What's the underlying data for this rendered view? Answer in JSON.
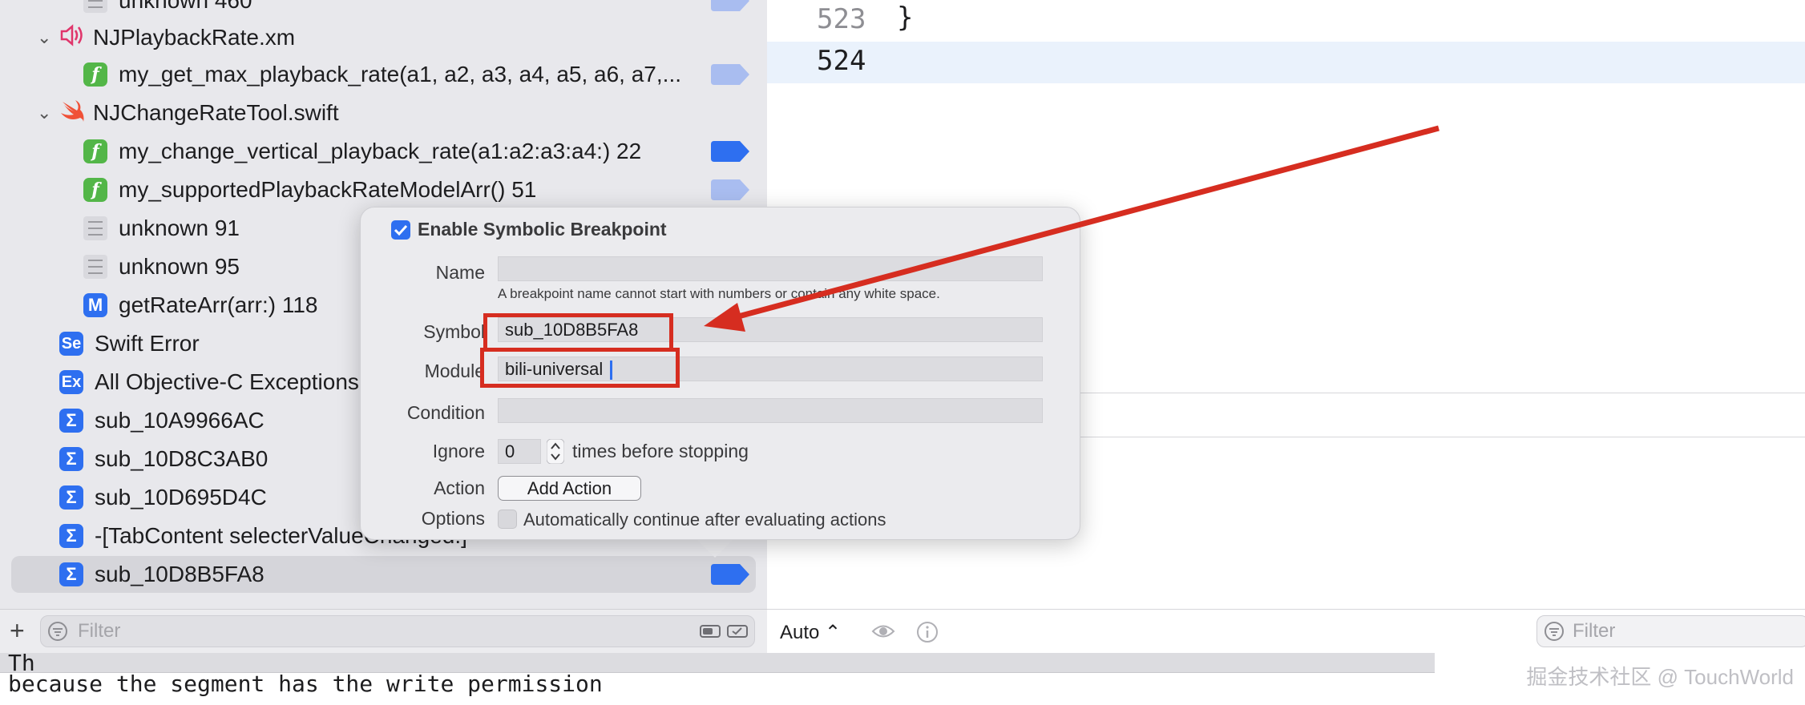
{
  "navigator": {
    "rows": [
      {
        "label": "unknown 460"
      },
      {
        "label": "NJPlaybackRate.xm"
      },
      {
        "label": "my_get_max_playback_rate(a1, a2, a3, a4, a5, a6, a7,..."
      },
      {
        "label": "NJChangeRateTool.swift"
      },
      {
        "label": "my_change_vertical_playback_rate(a1:a2:a3:a4:) 22"
      },
      {
        "label": "my_supportedPlaybackRateModelArr() 51"
      },
      {
        "label": "unknown 91"
      },
      {
        "label": "unknown 95"
      },
      {
        "label": "getRateArr(arr:) 118"
      },
      {
        "label": "Swift Error"
      },
      {
        "label": "All Objective-C Exceptions"
      },
      {
        "label": "sub_10A9966AC"
      },
      {
        "label": "sub_10D8C3AB0"
      },
      {
        "label": "sub_10D695D4C"
      },
      {
        "label": "-[TabContent selecterValueChanged:]"
      },
      {
        "label": "sub_10D8B5FA8"
      }
    ],
    "icon_letters": {
      "function": "f",
      "method": "M",
      "swift_error": "Se",
      "exception": "Ex",
      "symbolic": "Σ"
    },
    "filter_placeholder": "Filter"
  },
  "editor": {
    "line_numbers": [
      "523",
      "524"
    ],
    "code_line_523": "}",
    "bottom": {
      "auto_label": "Auto ⌃",
      "filter_placeholder": "Filter"
    }
  },
  "popover": {
    "enable_label": "Enable Symbolic Breakpoint",
    "enable_checked": true,
    "labels": {
      "name": "Name",
      "symbol": "Symbol",
      "module": "Module",
      "condition": "Condition",
      "ignore": "Ignore",
      "action": "Action",
      "options": "Options"
    },
    "name_value": "",
    "name_hint": "A breakpoint name cannot start with numbers or contain any white space.",
    "symbol_value": "sub_10D8B5FA8",
    "module_value": "bili-universal",
    "condition_value": "",
    "ignore_value": "0",
    "ignore_suffix": "times before stopping",
    "add_action_label": "Add Action",
    "auto_continue_label": "Automatically continue after evaluating actions",
    "auto_continue_checked": false
  },
  "terminal": {
    "prefix": "Th",
    "line": "because the segment has the write permission"
  },
  "watermark": "掘金技术社区 @ TouchWorld",
  "colors": {
    "breakpoint_active": "#2e6ff0",
    "breakpoint_inactive": "#a9bdf0",
    "annotation_red": "#d62d20",
    "function_icon": "#53b648",
    "symbolic_icon": "#2e6ff0"
  }
}
